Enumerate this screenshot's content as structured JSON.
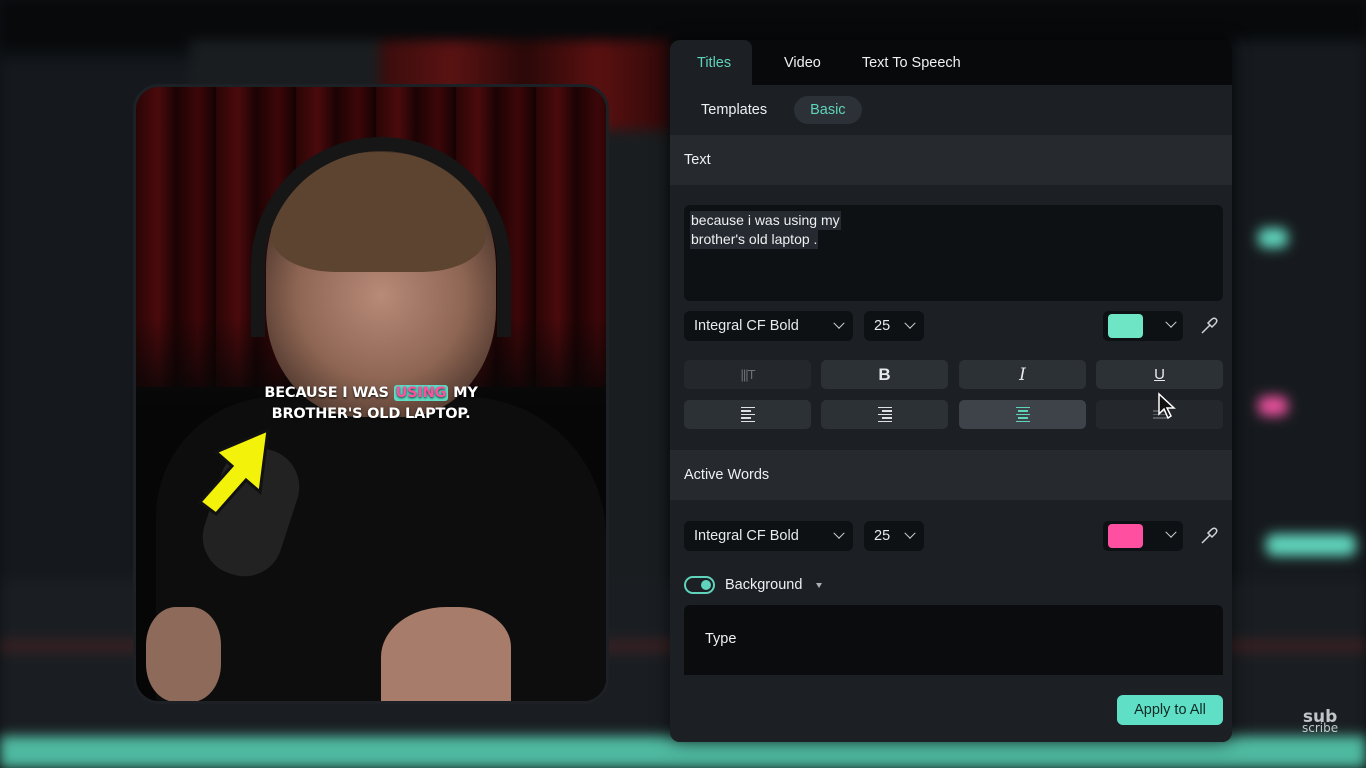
{
  "preview": {
    "caption": {
      "line1_before": "BECAUSE I WAS",
      "line1_active": "USING",
      "line1_after": "MY",
      "line2": "BROTHER'S OLD LAPTOP."
    },
    "active_word_bg_color": "#5fdcc4",
    "active_word_text_color": "#ff4fa0"
  },
  "panel": {
    "tabs": [
      {
        "label": "Titles",
        "active": true
      },
      {
        "label": "Video",
        "active": false
      },
      {
        "label": "Text To Speech",
        "active": false
      }
    ],
    "subtabs": [
      {
        "label": "Templates",
        "active": false
      },
      {
        "label": "Basic",
        "active": true
      }
    ],
    "text_section": {
      "title": "Text",
      "content_lines": [
        "because i was using my",
        "brother's old laptop ."
      ],
      "font": "Integral CF Bold",
      "size": "25",
      "color": "#6ee6c6",
      "format_buttons": [
        {
          "icon": "vertical-text-icon",
          "label": "",
          "enabled": false
        },
        {
          "icon": "bold-icon",
          "label": "B",
          "enabled": true
        },
        {
          "icon": "italic-icon",
          "label": "I",
          "enabled": true
        },
        {
          "icon": "underline-icon",
          "label": "U",
          "enabled": true
        }
      ],
      "align_buttons": [
        {
          "icon": "align-left-icon",
          "selected": false
        },
        {
          "icon": "align-right-icon",
          "selected": false
        },
        {
          "icon": "align-center-icon",
          "selected": true
        },
        {
          "icon": "align-justify-icon",
          "selected": false
        }
      ]
    },
    "active_words_section": {
      "title": "Active Words",
      "font": "Integral CF Bold",
      "size": "25",
      "color": "#ff4fa0",
      "background_toggle": {
        "label": "Background",
        "on": true
      },
      "type_label": "Type"
    },
    "apply_button": "Apply to All"
  },
  "watermark": {
    "line1": "sub",
    "line2": "scribe"
  },
  "colors": {
    "accent": "#5fd3bb",
    "apply_button": "#5fe0c6",
    "panel_bg": "#1c1f23"
  }
}
